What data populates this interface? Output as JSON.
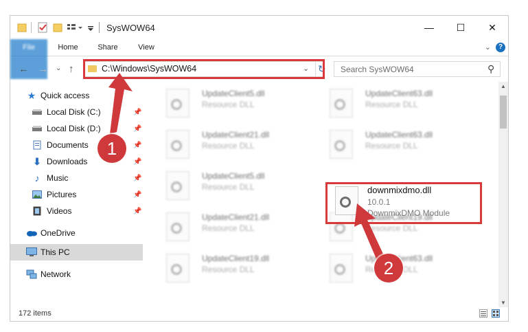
{
  "window": {
    "title": "SysWOW64",
    "minimize_glyph": "—",
    "maximize_glyph": "☐",
    "close_glyph": "✕"
  },
  "ribbon": {
    "tabs": [
      "File",
      "Home",
      "Share",
      "View"
    ],
    "collapse_glyph": "⌄",
    "help_glyph": "?"
  },
  "navbar": {
    "back_glyph": "←",
    "forward_glyph": "→",
    "recent_glyph": "⌄",
    "up_glyph": "↑"
  },
  "address": {
    "path": "C:\\Windows\\SysWOW64",
    "dropdown_glyph": "⌄",
    "refresh_glyph": "↻"
  },
  "search": {
    "placeholder": "Search SysWOW64",
    "icon": "search-icon"
  },
  "sidebar": {
    "items": [
      {
        "label": "Quick access",
        "icon": "star-icon"
      },
      {
        "label": "Local Disk (C:)",
        "icon": "drive-icon",
        "pinned": true
      },
      {
        "label": "Local Disk (D:)",
        "icon": "drive-icon",
        "pinned": true
      },
      {
        "label": "Documents",
        "icon": "documents-icon",
        "pinned": true
      },
      {
        "label": "Downloads",
        "icon": "downloads-icon",
        "pinned": true
      },
      {
        "label": "Music",
        "icon": "music-icon",
        "pinned": true
      },
      {
        "label": "Pictures",
        "icon": "pictures-icon",
        "pinned": true
      },
      {
        "label": "Videos",
        "icon": "videos-icon",
        "pinned": true
      },
      {
        "label": "OneDrive",
        "icon": "cloud-icon"
      },
      {
        "label": "This PC",
        "icon": "computer-icon",
        "selected": true
      },
      {
        "label": "Network",
        "icon": "network-icon"
      }
    ],
    "pin_glyph": "📌"
  },
  "files": {
    "left": [
      {
        "name": "UpdateClient5.dll",
        "type": "Resource DLL"
      },
      {
        "name": "UpdateClient21.dll",
        "type": "Resource DLL"
      },
      {
        "name": "UpdateClient5.dll",
        "type": "Resource DLL"
      },
      {
        "name": "UpdateClient21.dll",
        "type": "Resource DLL"
      },
      {
        "name": "UpdateClient19.dll",
        "type": "Resource DLL"
      }
    ],
    "right": [
      {
        "name": "UpdateClient63.dll",
        "type": "Resource DLL"
      },
      {
        "name": "UpdateClient63.dll",
        "type": "Resource DLL"
      },
      {
        "name": "UpdateClient19.dll",
        "type": "Resource DLL"
      },
      {
        "name": "UpdateClient63.dll",
        "type": "Resource DLL"
      }
    ],
    "highlighted": {
      "name": "downmixdmo.dll",
      "version": "10.0.1",
      "description": "DownmixDMO Module"
    }
  },
  "status": {
    "item_count": "172 items"
  },
  "annotations": {
    "step1": "1",
    "step2": "2",
    "color": "#d9393b"
  }
}
